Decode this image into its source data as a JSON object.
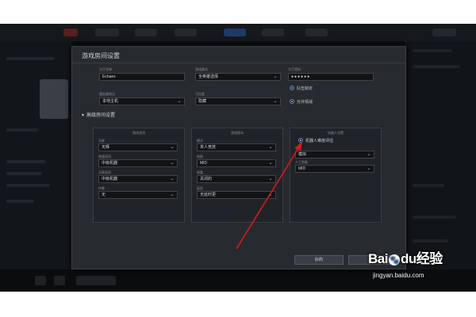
{
  "dialog": {
    "title": "游戏房间设置",
    "fields": {
      "lobby_name": {
        "label": "大厅名称",
        "value": "Echaex"
      },
      "game_mode": {
        "label": "游戏模式",
        "value": "全英雄选择"
      },
      "password": {
        "label": "大厅密码",
        "value": "●●●●●●"
      },
      "server_location": {
        "label": "服务器地点",
        "value": "本地主机"
      },
      "lobby_visibility": {
        "label": "可见度",
        "value": "隐藏"
      }
    },
    "radios": {
      "lock_teams": {
        "label": "队伍锁定",
        "checked": true
      },
      "allow_spectators": {
        "label": "允许观战",
        "checked": true
      }
    },
    "advanced_section": {
      "title": "高级房间设置",
      "panels": [
        {
          "title": "游戏选项",
          "rows": [
            {
              "label": "天辉",
              "value": "天辉"
            },
            {
              "label": "夜魇选项",
              "value": "中级机器"
            },
            {
              "label": "天辉选项",
              "value": "中级机器"
            },
            {
              "label": "作弊",
              "value": "无"
            }
          ]
        },
        {
          "title": "游戏版本",
          "rows": [
            {
              "label": "模式",
              "value": "单人竞技"
            },
            {
              "label": "地图",
              "value": "MID"
            },
            {
              "label": "观看",
              "value": "关闭的"
            },
            {
              "label": "延迟",
              "value": "无延时更"
            }
          ]
        },
        {
          "title": "机器人设置",
          "radio": {
            "label": "机器人难度评估",
            "checked": true
          },
          "rows": [
            {
              "label": "难度",
              "value": "模拟"
            },
            {
              "label": "人工智能",
              "value": "MID"
            }
          ]
        }
      ]
    },
    "buttons": {
      "ok": "好的",
      "cancel": "取消"
    }
  },
  "watermark": {
    "logo_a": "Bai",
    "logo_b": "du",
    "logo_c": "经验",
    "url": "jingyan.baidu.com"
  },
  "colors": {
    "dialog_bg": "#272a2f",
    "field_bg": "#111315",
    "accent_radio": "#6a90c4",
    "arrow": "#d81b1b"
  },
  "icons": {
    "dropdown": "chevron-down-icon",
    "section_toggle": "caret-down-icon",
    "paw": "paw-icon"
  }
}
